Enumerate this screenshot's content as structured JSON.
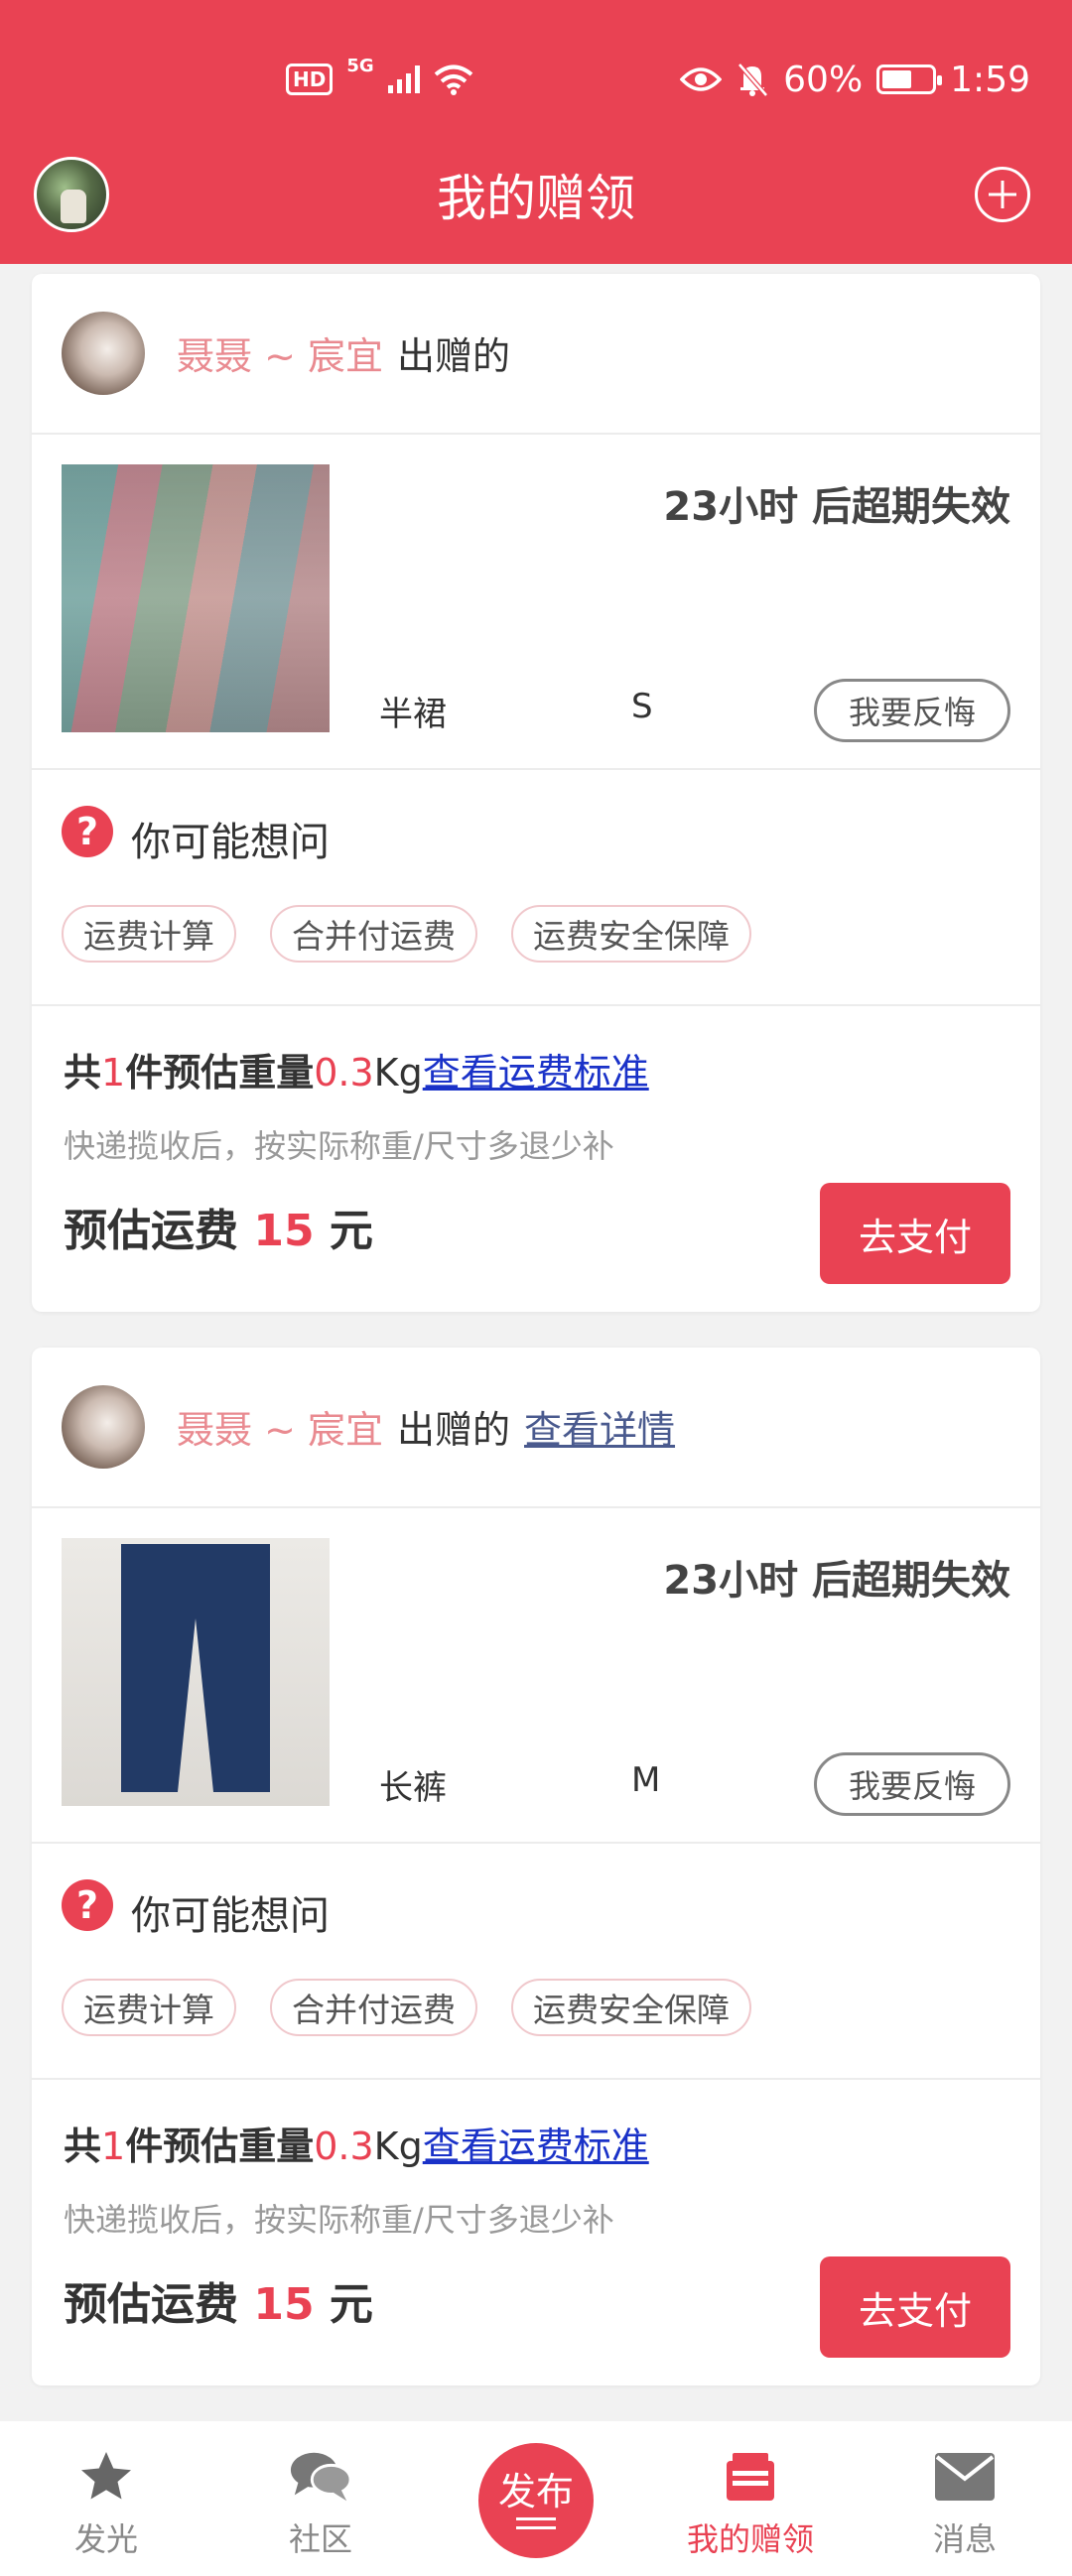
{
  "status_bar": {
    "hd_badge": "HD",
    "network": "5G",
    "battery": "60%",
    "time": "1:59"
  },
  "header": {
    "title": "我的赠领"
  },
  "gifts": [
    {
      "giver_name": "聂聂 ~ 宸宜",
      "giver_suffix": "出赠的",
      "detail_link": "",
      "expire_text": "23小时 后超期失效",
      "item_name": "半裙",
      "item_size": "S",
      "regret_label": "我要反悔",
      "faq_title": "你可能想问",
      "faq_chips": [
        "运费计算",
        "合并付运费",
        "运费安全保障"
      ],
      "count_prefix": "共",
      "count": "1",
      "count_unit": "件",
      "weight_label": "预估重量",
      "weight": "0.3",
      "weight_unit": "Kg",
      "standard_link": "查看运费标准",
      "note": "快递揽收后，按实际称重/尺寸多退少补",
      "fee_label": "预估运费",
      "fee": "15",
      "fee_unit": "元",
      "pay_label": "去支付"
    },
    {
      "giver_name": "聂聂 ~ 宸宜",
      "giver_suffix": "出赠的",
      "detail_link": "查看详情",
      "expire_text": "23小时 后超期失效",
      "item_name": "长裤",
      "item_size": "M",
      "regret_label": "我要反悔",
      "faq_title": "你可能想问",
      "faq_chips": [
        "运费计算",
        "合并付运费",
        "运费安全保障"
      ],
      "count_prefix": "共",
      "count": "1",
      "count_unit": "件",
      "weight_label": "预估重量",
      "weight": "0.3",
      "weight_unit": "Kg",
      "standard_link": "查看运费标准",
      "note": "快递揽收后，按实际称重/尺寸多退少补",
      "fee_label": "预估运费",
      "fee": "15",
      "fee_unit": "元",
      "pay_label": "去支付"
    }
  ],
  "bottom_nav": {
    "items": [
      {
        "label": "发光",
        "icon": "star-icon"
      },
      {
        "label": "社区",
        "icon": "chat-bubbles-icon"
      },
      {
        "label": "发布",
        "icon": "publish-icon"
      },
      {
        "label": "我的赠领",
        "icon": "gift-box-icon"
      },
      {
        "label": "消息",
        "icon": "envelope-icon"
      }
    ],
    "active": "我的赠领"
  },
  "colors": {
    "brand": "#e94253",
    "link": "#1a32c8",
    "nav_inactive": "#888888"
  }
}
